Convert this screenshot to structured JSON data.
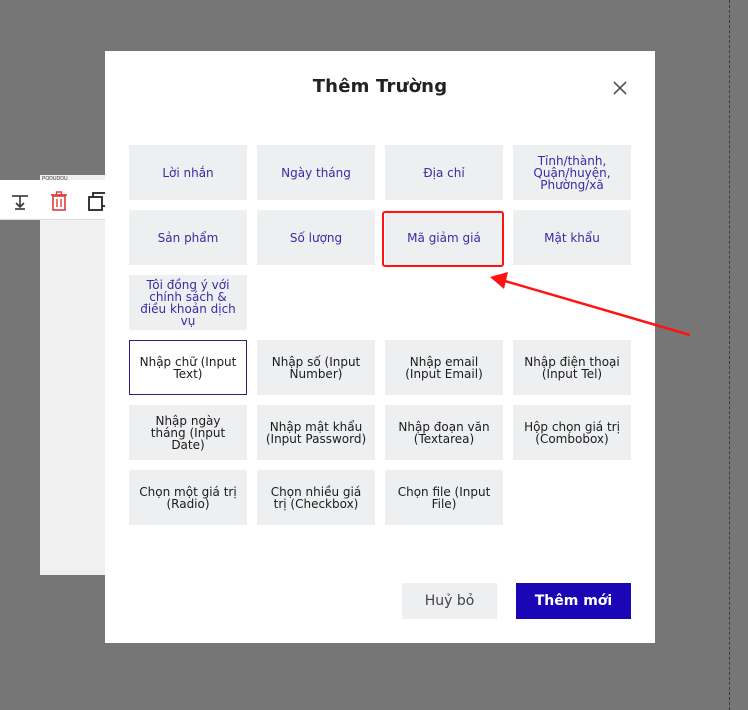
{
  "background": {
    "page_tiny_text": "PODUDOU"
  },
  "modal": {
    "title": "Thêm Trường",
    "options_purple": [
      "Lời nhắn",
      "Ngày tháng",
      "Địa chỉ",
      "Tỉnh/thành, Quận/huyện, Phường/xã",
      "Sản phẩm",
      "Số lượng",
      "Mã giảm giá",
      "Mật khẩu",
      "Tôi đồng ý với chính sách & điều khoản dịch vụ"
    ],
    "options_input": [
      "Nhập chữ (Input Text)",
      "Nhập số (Input Number)",
      "Nhập email (Input Email)",
      "Nhập điện thoại (Input Tel)",
      "Nhập ngày tháng (Input Date)",
      "Nhập mật khẩu (Input Password)",
      "Nhập đoạn văn (Textarea)",
      "Hộp chọn giá trị (Combobox)",
      "Chọn một giá trị (Radio)",
      "Chọn nhiều giá trị (Checkbox)",
      "Chọn file (Input File)"
    ],
    "selected_option": "Nhập chữ (Input Text)",
    "highlighted_option": "Mã giảm giá",
    "cancel_label": "Huỷ bỏ",
    "submit_label": "Thêm mới"
  },
  "colors": {
    "overlay": "#767676",
    "accent": "#1a06b5",
    "option_text_purple": "#3b2aa6",
    "annotation_red": "#ff1212"
  },
  "icons": {
    "close": "close-icon",
    "toolbar": [
      "align-icon",
      "trash-icon",
      "duplicate-icon"
    ]
  }
}
